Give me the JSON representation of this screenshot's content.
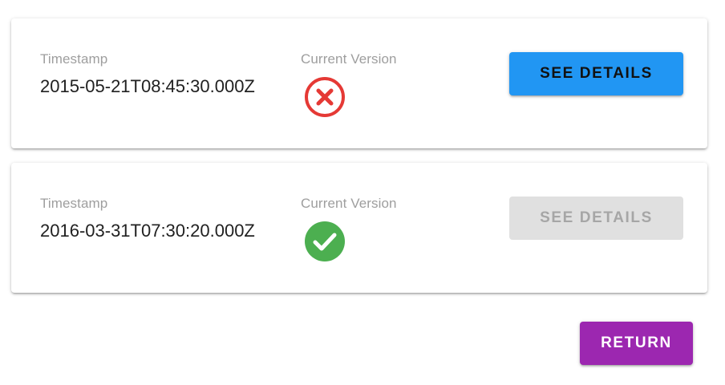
{
  "versions": [
    {
      "timestamp_label": "Timestamp",
      "timestamp": "2015-05-21T08:45:30.000Z",
      "current_version_label": "Current Version",
      "is_current": false,
      "status_icon": "error-circle-icon",
      "status_color": "#e53935",
      "details_label": "SEE DETAILS",
      "details_enabled": true
    },
    {
      "timestamp_label": "Timestamp",
      "timestamp": "2016-03-31T07:30:20.000Z",
      "current_version_label": "Current Version",
      "is_current": true,
      "status_icon": "check-circle-icon",
      "status_color": "#4caf50",
      "details_label": "SEE DETAILS",
      "details_enabled": false
    }
  ],
  "actions": {
    "return_label": "RETURN"
  },
  "colors": {
    "primary": "#2196f3",
    "secondary": "#9c27b0",
    "disabled_bg": "#e0e0e0",
    "disabled_text": "#a6a6a6"
  }
}
